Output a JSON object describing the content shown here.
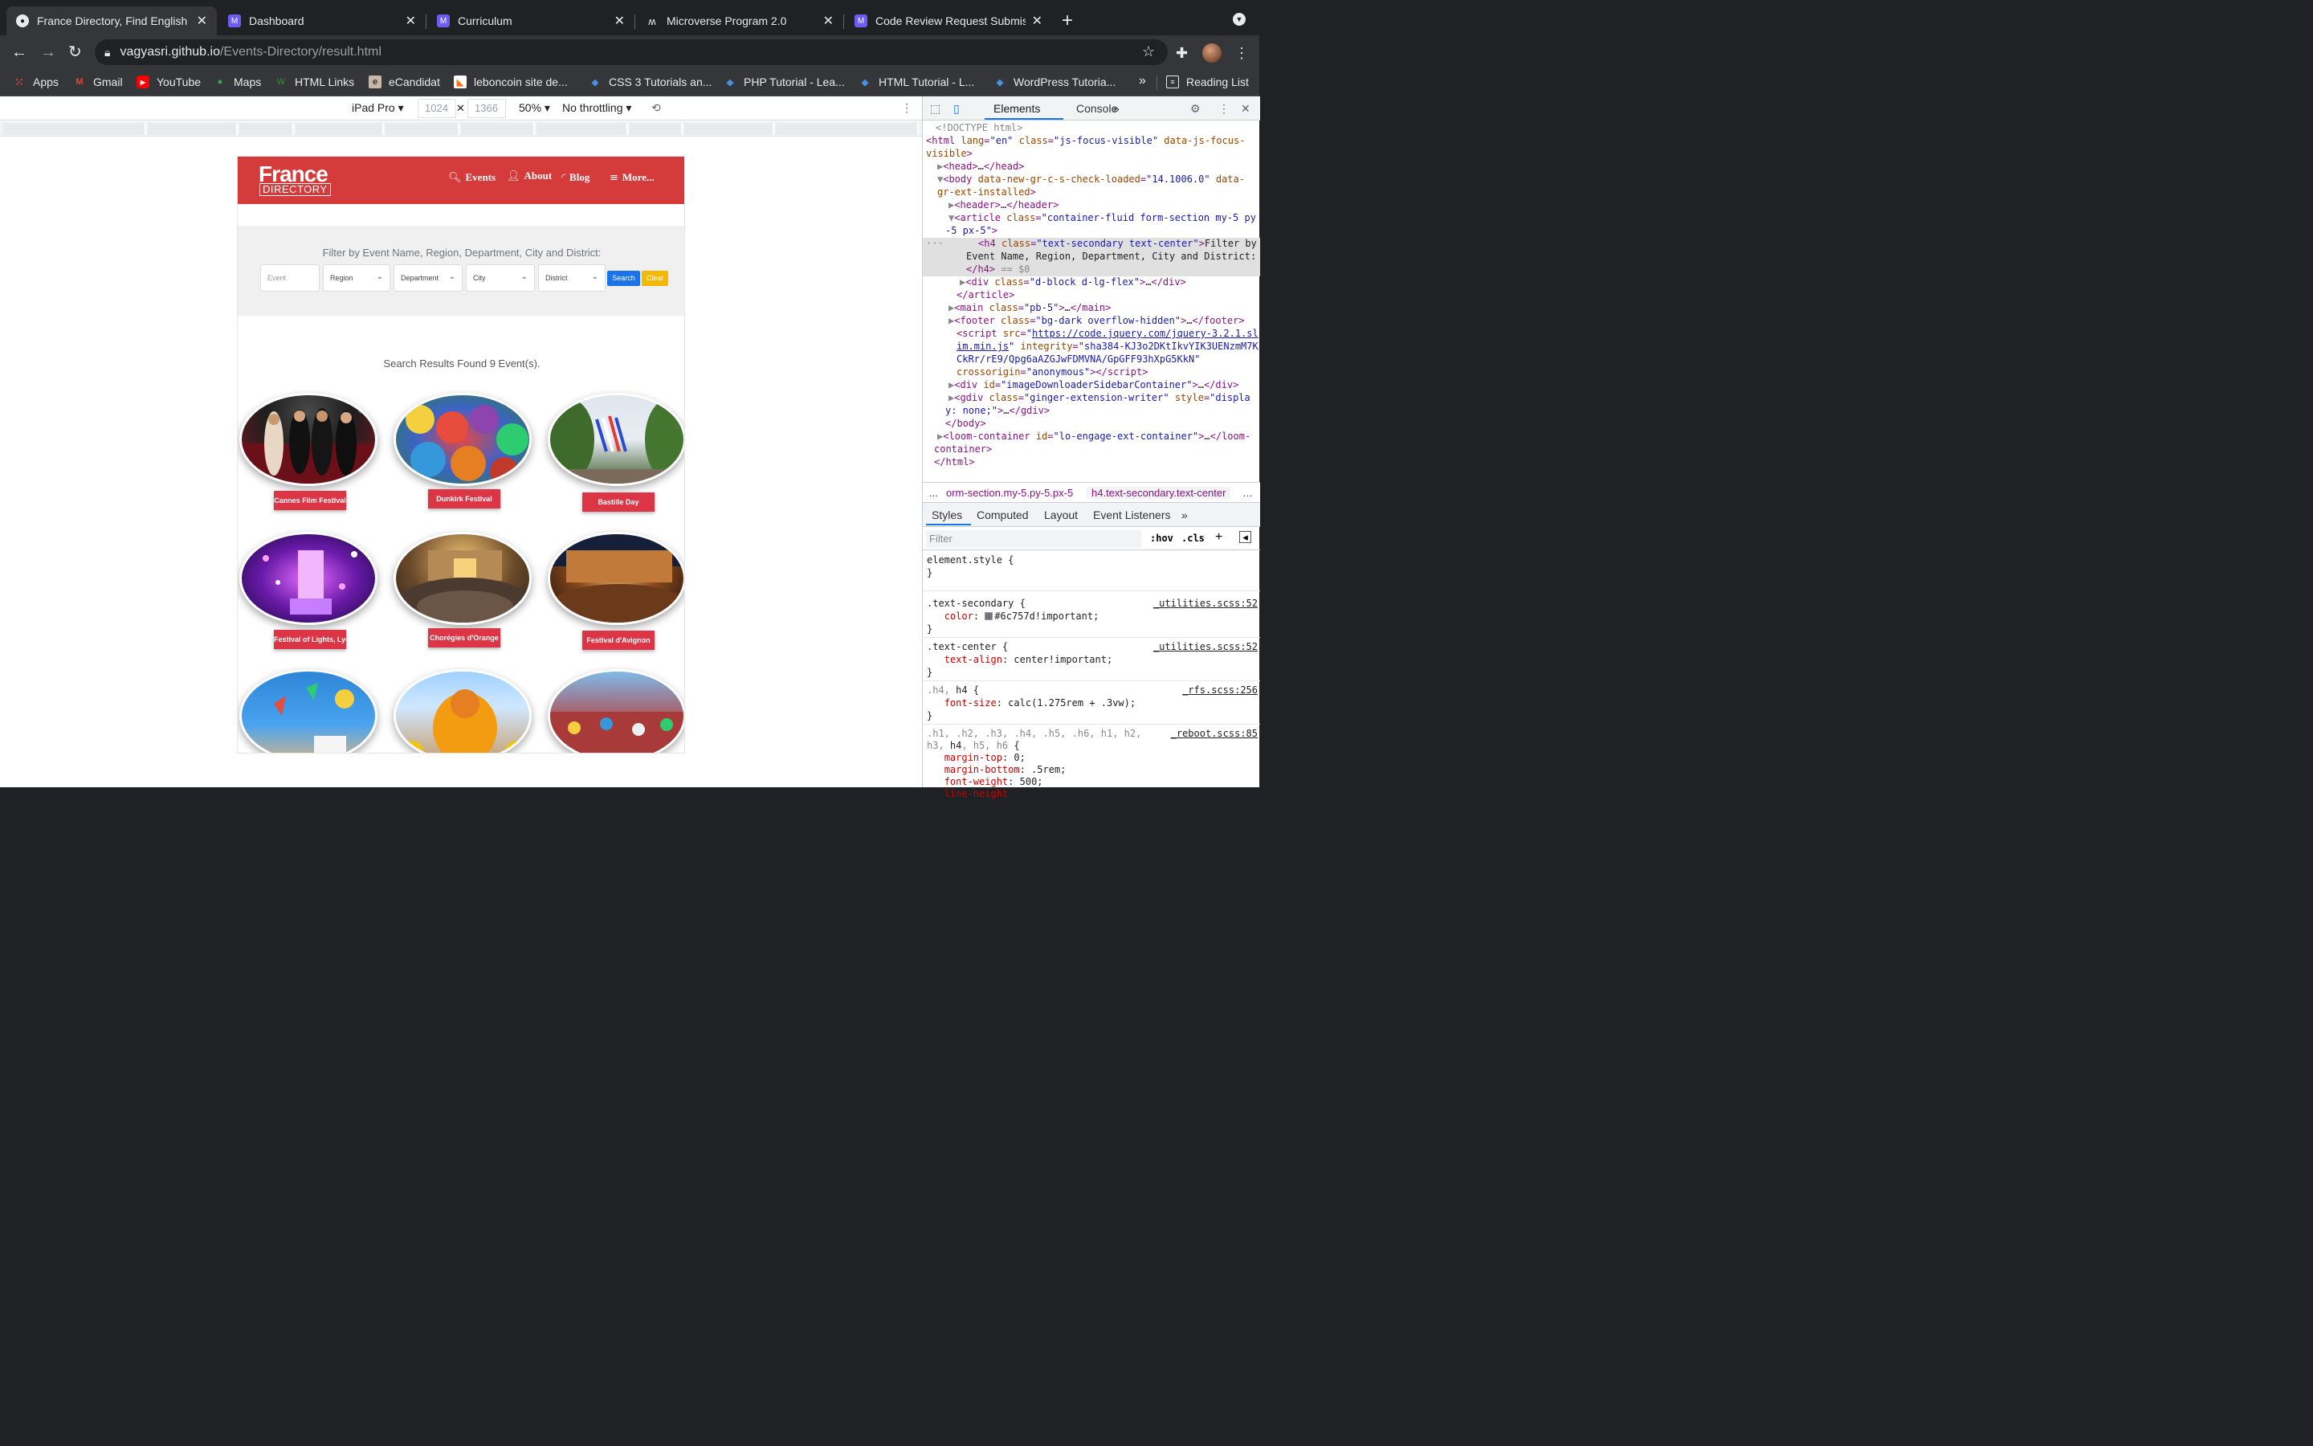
{
  "browser": {
    "tabs": [
      {
        "title": "France Directory, Find English"
      },
      {
        "title": "Dashboard"
      },
      {
        "title": "Curriculum"
      },
      {
        "title": "Microverse Program 2.0"
      },
      {
        "title": "Code Review Request Submiss"
      }
    ],
    "url": {
      "host": "vagyasri.github.io",
      "path": "/Events-Directory/result.html"
    },
    "bookmarks": [
      {
        "label": "Apps",
        "icon": "apps-grid-icon"
      },
      {
        "label": "Gmail",
        "icon": "gmail-icon"
      },
      {
        "label": "YouTube",
        "icon": "youtube-icon"
      },
      {
        "label": "Maps",
        "icon": "maps-pin-icon"
      },
      {
        "label": "HTML Links",
        "icon": "html-links-icon"
      },
      {
        "label": "eCandidat",
        "icon": "ecandidat-icon"
      },
      {
        "label": "leboncoin site de...",
        "icon": "leboncoin-icon"
      },
      {
        "label": "CSS 3 Tutorials an...",
        "icon": "tutorial-diamond-icon"
      },
      {
        "label": "PHP Tutorial - Lea...",
        "icon": "tutorial-diamond-icon"
      },
      {
        "label": "HTML Tutorial - L...",
        "icon": "tutorial-diamond-icon"
      },
      {
        "label": "WordPress Tutoria...",
        "icon": "tutorial-diamond-icon"
      }
    ],
    "bookmarks_overflow": "»",
    "reading_list": "Reading List"
  },
  "device_toolbar": {
    "device": "iPad Pro",
    "width": "1024",
    "height": "1366",
    "zoom": "50%",
    "throttling": "No throttling"
  },
  "site": {
    "logo_main": "France",
    "logo_sub": "DIRECTORY",
    "nav": [
      {
        "label": "Events",
        "icon": "search-icon"
      },
      {
        "label": "About",
        "icon": "user-icon"
      },
      {
        "label": "Blog",
        "icon": "rss-icon"
      },
      {
        "label": "More...",
        "icon": "menu-icon"
      }
    ],
    "filter_title": "Filter by Event Name, Region, Department, City and District:",
    "filter": {
      "event_placeholder": "Event",
      "region": "Region",
      "department": "Department",
      "city": "City",
      "district": "District",
      "search_label": "Search",
      "clear_label": "Clear"
    },
    "results_title": "Search Results Found 9 Event(s).",
    "events": [
      {
        "label": "Cannes Film Festival"
      },
      {
        "label": "Dunkirk Festival"
      },
      {
        "label": "Bastille Day"
      },
      {
        "label": "Festival of Lights, Lyon"
      },
      {
        "label": "Chorégies d'Orange"
      },
      {
        "label": "Festival d'Avignon"
      }
    ]
  },
  "devtools": {
    "tabs": [
      "Elements",
      "Console"
    ],
    "breadcrumbs": [
      "...",
      "orm-section.my-5.py-5.px-5",
      "h4.text-secondary.text-center"
    ],
    "style_tabs": [
      "Styles",
      "Computed",
      "Layout",
      "Event Listeners"
    ],
    "filter_placeholder": "Filter",
    "hov": ":hov",
    "cls": ".cls",
    "colors": {
      "text_secondary": "#6c757d"
    }
  }
}
